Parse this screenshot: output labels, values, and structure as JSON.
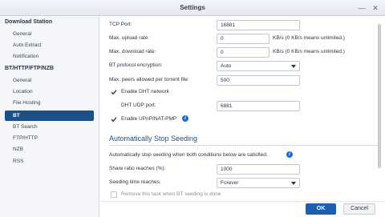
{
  "window": {
    "title": "Settings"
  },
  "sidebar": {
    "groups": [
      {
        "label": "Download Station",
        "items": [
          "General",
          "Auto Extract",
          "Notification"
        ]
      },
      {
        "label": "BT/HTTP/FTP/NZB",
        "items": [
          "General",
          "Location",
          "File Hosting",
          "BT",
          "BT Search",
          "FTP/HTTP",
          "NZB",
          "RSS"
        ]
      }
    ],
    "active_item": "BT"
  },
  "bt": {
    "tcp_port_label": "TCP Port:",
    "tcp_port_value": "16881",
    "upload_label": "Max. upload rate:",
    "upload_value": "0",
    "upload_hint": "KB/s (0 KB/s means unlimited.)",
    "download_label": "Max. download rate:",
    "download_value": "0",
    "download_hint": "KB/s (0 KB/s means unlimited.)",
    "encryption_label": "BT protocol encryption:",
    "encryption_value": "Auto",
    "peers_label": "Max. peers allowed per torrent file:",
    "peers_value": "500",
    "dht_label": "Enable DHT network",
    "dht_checked": true,
    "dht_port_label": "DHT UDP port:",
    "dht_port_value": "6881",
    "upnp_label": "Enable UPnP/NAT-PMP",
    "upnp_checked": true
  },
  "seeding": {
    "section_title": "Automatically Stop Seeding",
    "description": "Automatically stop seeding when both conditions below are satisfied:",
    "ratio_label": "Share ratio reaches (%):",
    "ratio_value": "1000",
    "time_label": "Seeding time reaches:",
    "time_value": "Forever",
    "remove_label": "Remove this task when BT seeding is done",
    "remove_checked": false
  },
  "footer": {
    "ok_label": "OK",
    "cancel_label": "Cancel"
  },
  "colors": {
    "accent": "#1e4f84",
    "primary_button": "#1a5fb4",
    "info_icon": "#1a6fd1"
  }
}
